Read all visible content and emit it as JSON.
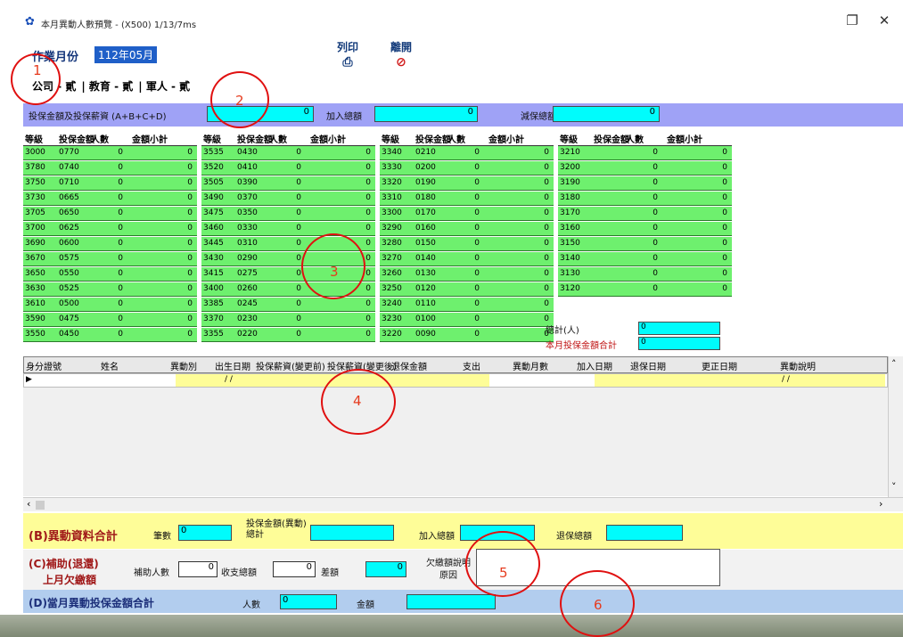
{
  "window": {
    "title": "本月異動人數預覽 - (X500) 1/13/7ms",
    "restore_glyph": "❐",
    "close_glyph": "✕"
  },
  "toolbar": {
    "work_month_label": "作業月份",
    "work_month_value": "112年05月",
    "print_label": "列印",
    "print_icon": "printer-icon",
    "close_label": "離開",
    "close_icon": "cancel-icon"
  },
  "tabs": [
    "公司 - 貳",
    "教育 - 貳",
    "軍人 - 貳"
  ],
  "filters": [
    {
      "label": "投保金額及投保薪資 (A+B+C+D)",
      "value": "0"
    },
    {
      "label": "加入總額",
      "value": "0"
    },
    {
      "label": "減保總額",
      "value": "0"
    }
  ],
  "grade_table": {
    "columns": [
      "等級",
      "投保金額",
      "人數",
      "金額小計"
    ],
    "blocks": [
      {
        "grades": [
          "3000",
          "3780",
          "3750",
          "3730",
          "3705",
          "3700",
          "3690",
          "3670",
          "3650",
          "3630",
          "3610",
          "3590",
          "3550"
        ],
        "amounts": [
          "0770",
          "0740",
          "0710",
          "0665",
          "0650",
          "0625",
          "0600",
          "0575",
          "0550",
          "0525",
          "0500",
          "0475",
          "0450"
        ]
      },
      {
        "grades": [
          "3535",
          "3520",
          "3505",
          "3490",
          "3475",
          "3460",
          "3445",
          "3430",
          "3415",
          "3400",
          "3385",
          "3370",
          "3355"
        ],
        "amounts": [
          "0430",
          "0410",
          "0390",
          "0370",
          "0350",
          "0330",
          "0310",
          "0290",
          "0275",
          "0260",
          "0245",
          "0230",
          "0220"
        ]
      },
      {
        "grades": [
          "3340",
          "3330",
          "3320",
          "3310",
          "3300",
          "3290",
          "3280",
          "3270",
          "3260",
          "3250",
          "3240",
          "3230",
          "3220"
        ],
        "amounts": [
          "0210",
          "0200",
          "0190",
          "0180",
          "0170",
          "0160",
          "0150",
          "0140",
          "0130",
          "0120",
          "0110",
          "0100",
          "0090"
        ]
      },
      {
        "grades": [
          "3210",
          "3200",
          "3190",
          "3180",
          "3170",
          "3160",
          "3150",
          "3140",
          "3130",
          "3120"
        ],
        "amounts": [
          "",
          "",
          "",
          "",
          "",
          "",
          "",
          "",
          "",
          ""
        ]
      }
    ],
    "count_zero": "0",
    "sum_zero": "0",
    "total_count_label": "總計(人)",
    "total_count_value": "0",
    "total_amount_label": "本月投保金額合計",
    "total_amount_value": "0"
  },
  "detail_grid": {
    "columns": [
      "身分證號",
      "姓名",
      "異動別",
      "出生日期",
      "投保薪資(變更前)",
      "投保薪資(變更後)",
      "退保金額",
      "支出",
      "異動月數",
      "加入日期",
      "退保日期",
      "更正日期",
      "異動說明"
    ],
    "row_date_marks": [
      "/ /",
      "/ /"
    ]
  },
  "section_b": {
    "title": "(B)異動資料合計",
    "f1_label": "筆數",
    "f1_value": "0",
    "f2_label": "投保金額(異動) 總計",
    "f2_value": "",
    "f3_label": "加入總額",
    "f3_value": "",
    "f4_label": "退保總額",
    "f4_value": ""
  },
  "section_c": {
    "title_line1": "(C)補助(退還)",
    "title_line2": "上月欠繳額",
    "f1_label": "補助人數",
    "f1_value": "0",
    "f2_label": "收支總額",
    "f2_value": "0",
    "f3_label": "差額",
    "f3_value": "0",
    "note_label": "欠繳額說明原因",
    "note_value": ""
  },
  "section_d": {
    "title": "(D)當月異動投保金額合計",
    "f1_label": "人數",
    "f1_value": "0",
    "f2_label": "金額",
    "f2_value": ""
  },
  "callouts": [
    "1",
    "2",
    "3",
    "4",
    "5",
    "6"
  ],
  "scroll_glyphs": {
    "left": "‹",
    "right": "›",
    "up": "˄",
    "down": "˅"
  }
}
